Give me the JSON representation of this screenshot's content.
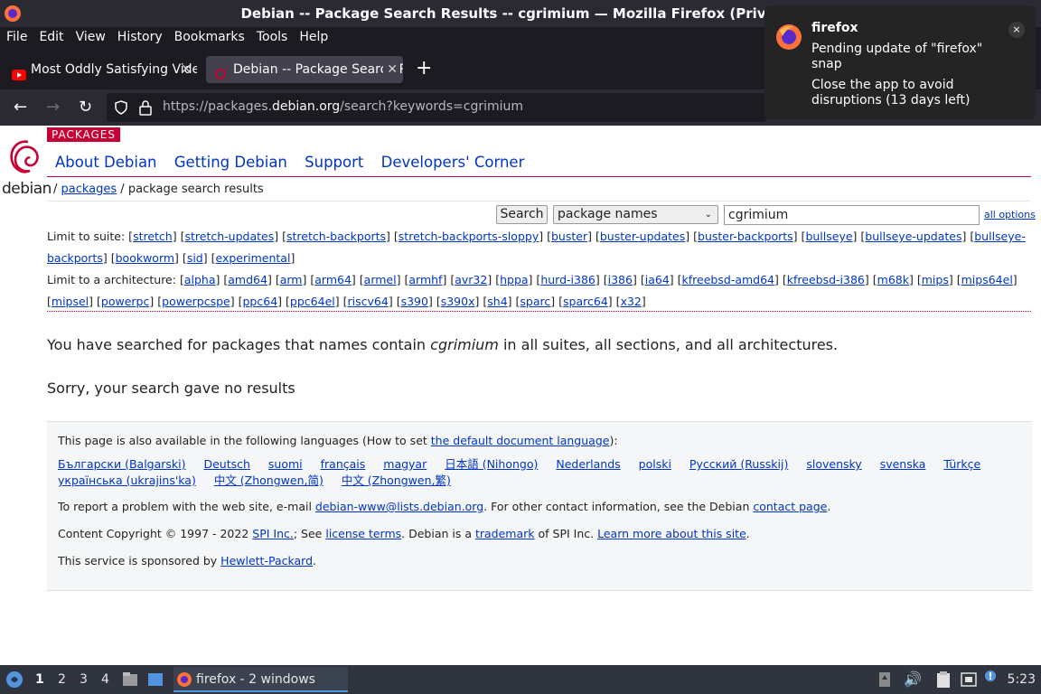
{
  "window": {
    "title": "Debian -- Package Search Results -- cgrimium — Mozilla Firefox (Private Browsing)"
  },
  "menubar": [
    "File",
    "Edit",
    "View",
    "History",
    "Bookmarks",
    "Tools",
    "Help"
  ],
  "tabs": [
    {
      "label": "Most Oddly Satisfying Video",
      "icon": "youtube-icon",
      "active": false
    },
    {
      "label": "Debian -- Package Search Results",
      "icon": "debian-icon",
      "active": true
    }
  ],
  "navbar": {
    "url_prefix": "https://packages.",
    "url_domain": "debian.org",
    "url_path": "/search?keywords=cgrimium"
  },
  "notification": {
    "app": "firefox",
    "message": "Pending update of \"firefox\" snap",
    "detail": "Close the app to avoid disruptions (13 days left)",
    "close": "×"
  },
  "page": {
    "logo_text": "debian",
    "section_badge": "PACKAGES",
    "topnav": [
      "About Debian",
      "Getting Debian",
      "Support",
      "Developers' Corner"
    ],
    "breadcrumb": {
      "sep1": "/ ",
      "link": "packages",
      "rest": " / package search results"
    },
    "search": {
      "button": "Search",
      "mode": "package names",
      "query": "cgrimium",
      "all_options": "all options"
    },
    "suites_label": "Limit to suite:",
    "suites": [
      "stretch",
      "stretch-updates",
      "stretch-backports",
      "stretch-backports-sloppy",
      "buster",
      "buster-updates",
      "buster-backports",
      "bullseye",
      "bullseye-updates",
      "bullseye-backports",
      "bookworm",
      "sid",
      "experimental"
    ],
    "archs_label": "Limit to a architecture:",
    "archs": [
      "alpha",
      "amd64",
      "arm",
      "arm64",
      "armel",
      "armhf",
      "avr32",
      "hppa",
      "hurd-i386",
      "i386",
      "ia64",
      "kfreebsd-amd64",
      "kfreebsd-i386",
      "m68k",
      "mips",
      "mips64el",
      "mipsel",
      "powerpc",
      "powerpcspe",
      "ppc64",
      "ppc64el",
      "riscv64",
      "s390",
      "s390x",
      "sh4",
      "sparc",
      "sparc64",
      "x32"
    ],
    "searched_pre": "You have searched for packages that names contain ",
    "searched_kw": "cgrimium",
    "searched_post": " in all suites, all sections, and all architectures.",
    "no_results": "Sorry, your search gave no results"
  },
  "footer": {
    "lang_pre": "This page is also available in the following languages (How to set ",
    "lang_link": "the default document language",
    "lang_post": "):",
    "languages": [
      "Български (Balgarski)",
      "Deutsch",
      "suomi",
      "français",
      "magyar",
      "日本語 (Nihongo)",
      "Nederlands",
      "polski",
      "Русский (Russkij)",
      "slovensky",
      "svenska",
      "Türkçe",
      "українська (ukrajins'ka)",
      "中文 (Zhongwen,简)",
      "中文 (Zhongwen,繁)"
    ],
    "report_pre": "To report a problem with the web site, e-mail ",
    "report_email": "debian-www@lists.debian.org",
    "report_mid": ". For other contact information, see the Debian ",
    "report_link": "contact page",
    "report_post": ".",
    "copy_pre": "Content Copyright © 1997 - 2022 ",
    "copy_spi": "SPI Inc.",
    "copy_mid1": "; See ",
    "copy_license": "license terms",
    "copy_mid2": ". Debian is a ",
    "copy_trademark": "trademark",
    "copy_mid3": " of SPI Inc. ",
    "copy_learn": "Learn more about this site",
    "copy_post": ".",
    "sponsor_pre": "This service is sponsored by ",
    "sponsor_link": "Hewlett-Packard",
    "sponsor_post": "."
  },
  "taskbar": {
    "workspaces": [
      "1",
      "2",
      "3",
      "4"
    ],
    "task_label": "firefox - 2 windows",
    "clock": "5:23"
  },
  "colors": {
    "debian_red": "#c70036",
    "link": "#0035c7",
    "firefox_dark": "#1c1b22"
  }
}
